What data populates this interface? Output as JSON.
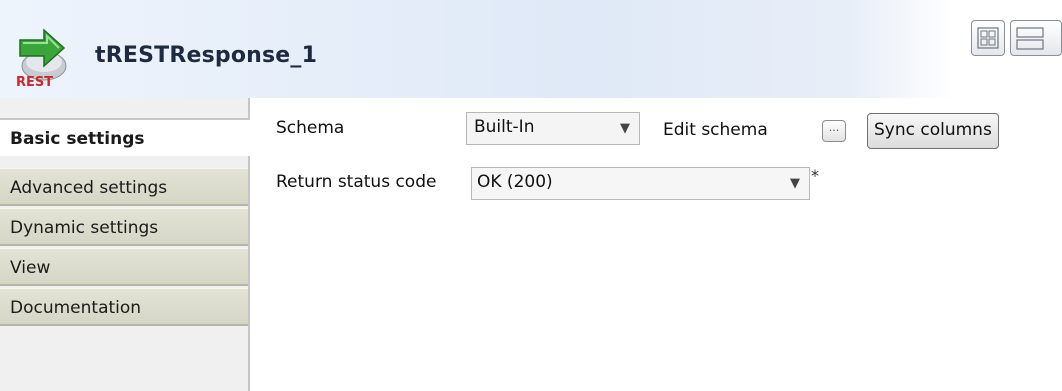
{
  "header": {
    "title": "tRESTResponse_1",
    "icon_badge": "REST",
    "view_buttons": [
      "grid-view-icon",
      "list-view-icon"
    ]
  },
  "sidebar": {
    "tabs": [
      {
        "label": "Basic settings",
        "active": true
      },
      {
        "label": "Advanced settings",
        "active": false
      },
      {
        "label": "Dynamic settings",
        "active": false
      },
      {
        "label": "View",
        "active": false
      },
      {
        "label": "Documentation",
        "active": false
      }
    ]
  },
  "form": {
    "schema_label": "Schema",
    "schema_value": "Built-In",
    "edit_schema_label": "Edit schema",
    "edit_schema_button": "...",
    "sync_columns_label": "Sync columns",
    "return_status_label": "Return status code",
    "return_status_value": "OK (200)",
    "required_marker": "*"
  },
  "colors": {
    "header_bg": "#dfe9f7",
    "tab_bg": "#d6d6c6",
    "arrow_green": "#3aa63a",
    "badge_red": "#d0262c"
  }
}
